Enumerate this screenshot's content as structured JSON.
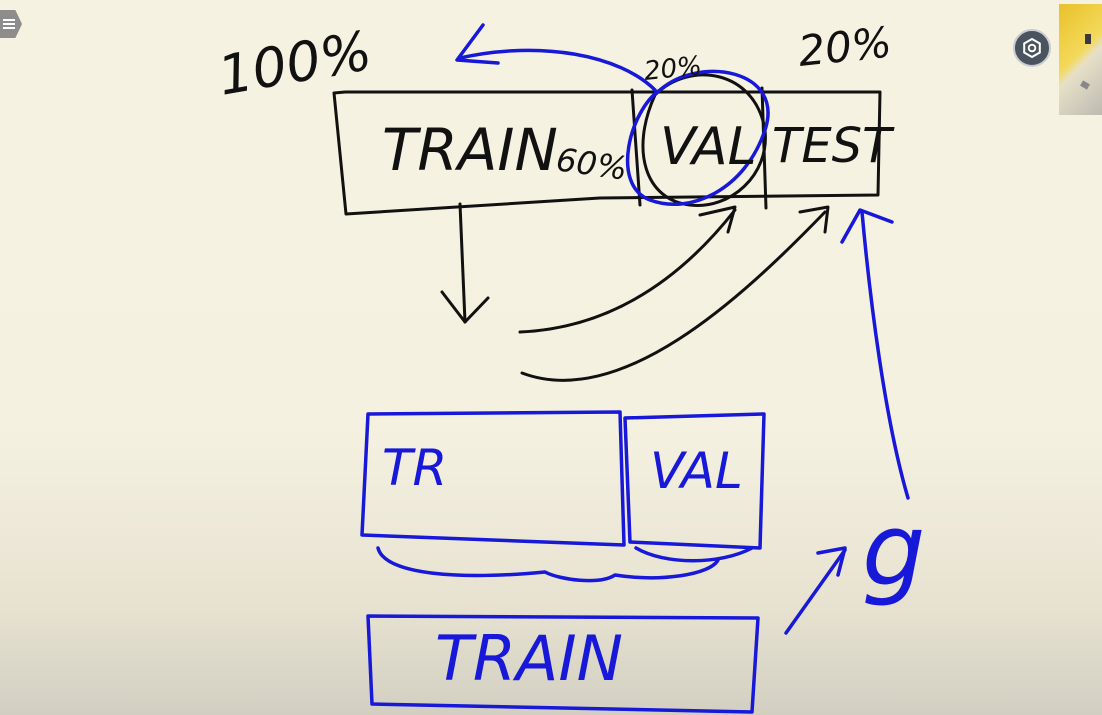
{
  "board": {
    "label_100": "100%",
    "label_20_val": "20%",
    "label_20_test": "20%",
    "label_60": "60%",
    "seg_train": "TRAIN",
    "seg_val": "VAL",
    "seg_test": "TEST",
    "box_tr": "TR",
    "box_val": "VAL",
    "box_train": "TRAIN",
    "letter_g": "g"
  },
  "colors": {
    "background": "#f6f2e2",
    "ink_black": "#111111",
    "ink_blue": "#1818d8"
  },
  "icons": {
    "menu": "hamburger-menu-icon",
    "settings": "settings-gear-icon"
  }
}
